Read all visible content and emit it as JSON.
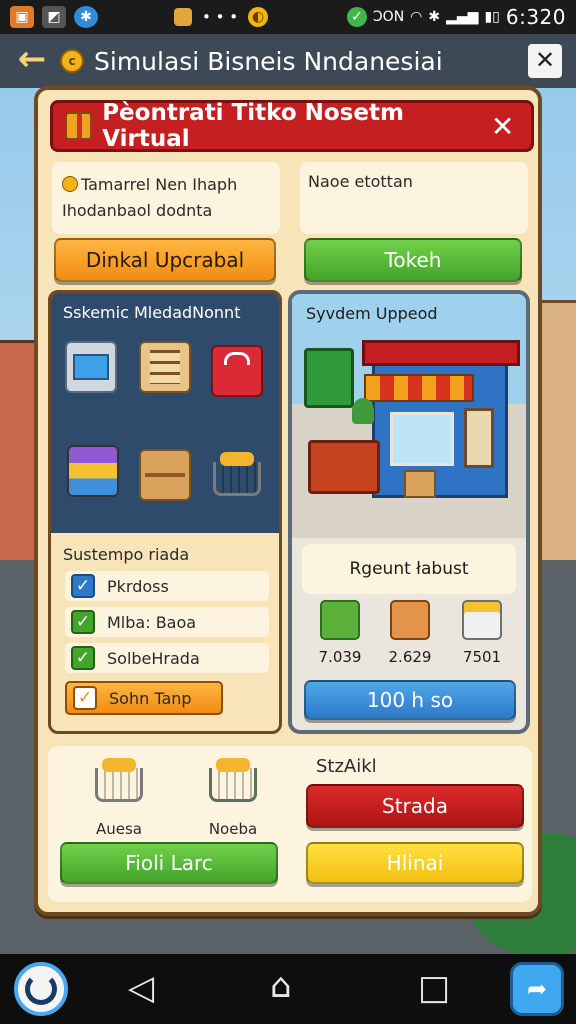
{
  "status_bar": {
    "time": "6:320",
    "center_text": "• • •",
    "net_text": "ƆON",
    "colors": {
      "bg": "#1b1b1b"
    },
    "icons": [
      "gift-icon",
      "gallery-icon",
      "bluetooth-app-icon",
      "package-icon",
      "coin-icon",
      "status-check-icon",
      "wifi-icon",
      "bluetooth-icon",
      "signal-icon",
      "battery-icon"
    ]
  },
  "header": {
    "title": "Simulasi Bisneis Nndanesiai",
    "back_icon": "arrow-left-icon",
    "close_icon": "close-icon"
  },
  "dialog": {
    "title": "Pèontrati  Titko Nosetm Virtual",
    "close_symbol": "✕",
    "info_left_line1": "Tamarrel Nen Ihaph",
    "info_left_line2": "Ihodanbaol dodnta",
    "info_right": "Naoe etottan",
    "btn_left": "Dinkal Upcrabal",
    "btn_right": "Tokeh"
  },
  "system_panel": {
    "title": "Sskemic MledadNonnt",
    "icons": [
      "laptop-icon",
      "shelf-icon",
      "shopping-bag-icon",
      "stacked-boxes-icon",
      "box-icon",
      "cart-icon"
    ],
    "checklist_title": "Sustempo riada",
    "checklist": [
      {
        "label": "Pkrdoss",
        "checked": true,
        "style": "blue"
      },
      {
        "label": "Mlba: Baoa",
        "checked": true,
        "style": "green"
      },
      {
        "label": "SolbeHrada",
        "checked": true,
        "style": "green"
      },
      {
        "label": "Sohn Tanp",
        "checked": true,
        "style": "orange-active"
      }
    ]
  },
  "store_panel": {
    "title": "Syvdem Uppeod",
    "result_label": "Rgeunt łabust",
    "products": [
      {
        "icon": "green-crate-icon",
        "value": "7.039"
      },
      {
        "icon": "orange-basket-icon",
        "value": "2.629"
      },
      {
        "icon": "white-container-icon",
        "value": "7501"
      }
    ],
    "button": "100 h so"
  },
  "bottom": {
    "carts": [
      {
        "icon": "orange-cart-icon",
        "label": "Auesa"
      },
      {
        "icon": "green-cart-icon",
        "label": "Noeba"
      }
    ],
    "status_label": "StzAikl",
    "btn_red": "Strada",
    "btn_green": "Fioli Larc",
    "btn_yellow": "Hlinai"
  },
  "navbar": {
    "icons": [
      "app-launcher-icon",
      "back-triangle-icon",
      "home-icon",
      "recents-square-icon",
      "share-icon"
    ]
  },
  "colors": {
    "title_red": "#c61f22",
    "panel_cream": "#f7e4b8",
    "green": "#43a42a",
    "orange": "#f08c15",
    "blue": "#2e7ac9",
    "yellow": "#f2bf10"
  }
}
